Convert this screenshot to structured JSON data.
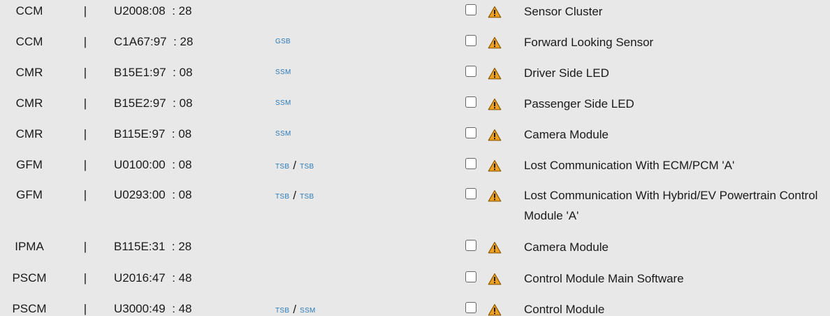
{
  "rows": [
    {
      "module": "CCM",
      "sep": "|",
      "dtc": "U2008",
      "b1": "08",
      "b2": "28",
      "links": [],
      "description": "Sensor Cluster"
    },
    {
      "module": "CCM",
      "sep": "|",
      "dtc": "C1A67",
      "b1": "97",
      "b2": "28",
      "links": [
        "GSB"
      ],
      "description": "Forward Looking Sensor"
    },
    {
      "module": "CMR",
      "sep": "|",
      "dtc": "B15E1",
      "b1": "97",
      "b2": "08",
      "links": [
        "SSM"
      ],
      "description": "Driver Side LED"
    },
    {
      "module": "CMR",
      "sep": "|",
      "dtc": "B15E2",
      "b1": "97",
      "b2": "08",
      "links": [
        "SSM"
      ],
      "description": "Passenger Side LED"
    },
    {
      "module": "CMR",
      "sep": "|",
      "dtc": "B115E",
      "b1": "97",
      "b2": "08",
      "links": [
        "SSM"
      ],
      "description": "Camera Module"
    },
    {
      "module": "GFM",
      "sep": "|",
      "dtc": "U0100",
      "b1": "00",
      "b2": "08",
      "links": [
        "TSB",
        "TSB"
      ],
      "description": "Lost Communication With ECM/PCM 'A'"
    },
    {
      "module": "GFM",
      "sep": "|",
      "dtc": "U0293",
      "b1": "00",
      "b2": "08",
      "links": [
        "TSB",
        "TSB"
      ],
      "description": "Lost Communication With Hybrid/EV Powertrain Control Module 'A'"
    },
    {
      "module": "IPMA",
      "sep": "|",
      "dtc": "B115E",
      "b1": "31",
      "b2": "28",
      "links": [],
      "description": "Camera Module"
    },
    {
      "module": "PSCM",
      "sep": "|",
      "dtc": "U2016",
      "b1": "47",
      "b2": "48",
      "links": [],
      "description": "Control Module Main Software"
    },
    {
      "module": "PSCM",
      "sep": "|",
      "dtc": "U3000",
      "b1": "49",
      "b2": "48",
      "links": [
        "TSB",
        "SSM"
      ],
      "description": "Control Module"
    }
  ],
  "colors": {
    "background": "#e8e8e8",
    "link": "#2a7ab8",
    "warning_fill": "#f0a020",
    "warning_stroke": "#8a5a00"
  },
  "icons": {
    "checkbox": "checkbox-icon",
    "warning": "warning-triangle-icon"
  }
}
